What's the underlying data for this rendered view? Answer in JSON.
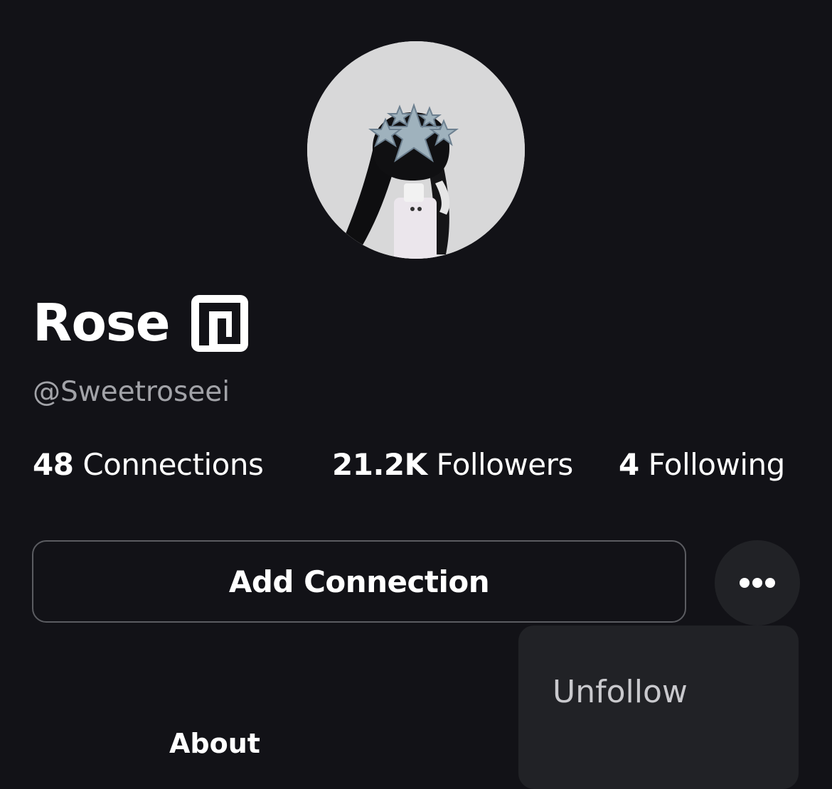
{
  "profile": {
    "display_name": "Rose",
    "username": "@Sweetroseei",
    "verified_badge_icon": "premium-badge-icon"
  },
  "stats": {
    "connections": {
      "count": "48",
      "label": "Connections"
    },
    "followers": {
      "count": "21.2K",
      "label": "Followers"
    },
    "following": {
      "count": "4",
      "label": "Following"
    }
  },
  "actions": {
    "add_connection_label": "Add Connection",
    "more_icon": "ellipsis-icon"
  },
  "menu": {
    "items": [
      {
        "label": "Unfollow"
      }
    ]
  },
  "tabs": {
    "about_label": "About"
  },
  "colors": {
    "background": "#121217",
    "surface": "#212226",
    "text_primary": "#ffffff",
    "text_secondary": "#a2a3a8",
    "border": "#5b5c61"
  }
}
